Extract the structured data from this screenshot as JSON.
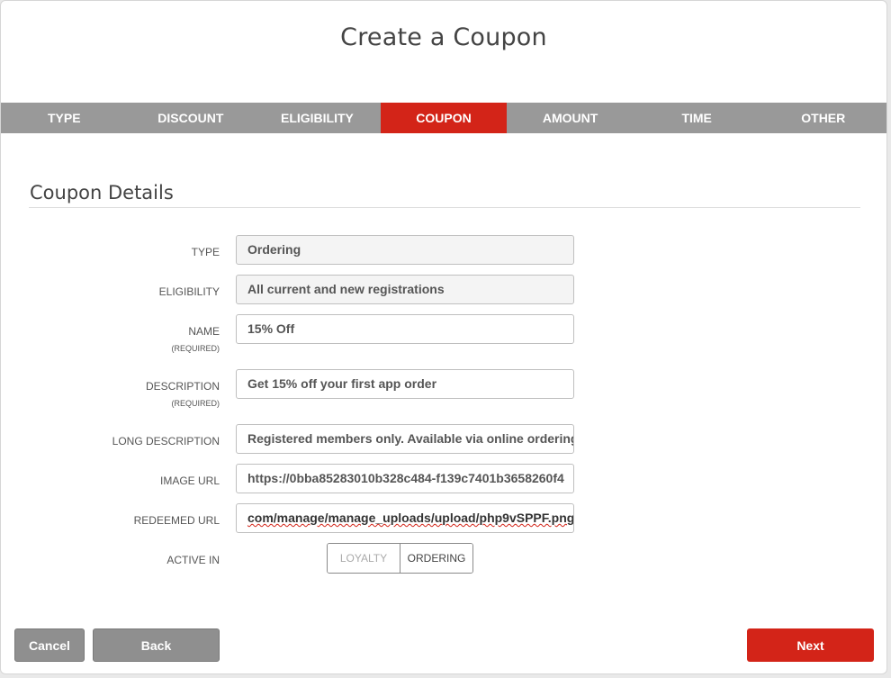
{
  "title": "Create a Coupon",
  "tabs": [
    {
      "label": "TYPE"
    },
    {
      "label": "DISCOUNT"
    },
    {
      "label": "ELIGIBILITY"
    },
    {
      "label": "COUPON",
      "active": true
    },
    {
      "label": "AMOUNT"
    },
    {
      "label": "TIME"
    },
    {
      "label": "OTHER"
    }
  ],
  "section": {
    "title": "Coupon Details"
  },
  "form": {
    "type": {
      "label": "TYPE",
      "value": "Ordering"
    },
    "eligibility": {
      "label": "ELIGIBILITY",
      "value": "All current and new registrations"
    },
    "name": {
      "label": "NAME",
      "required": "(REQUIRED)",
      "value": "15% Off"
    },
    "description": {
      "label": "DESCRIPTION",
      "required": "(REQUIRED)",
      "value": "Get 15% off your first app order"
    },
    "long_description": {
      "label": "LONG DESCRIPTION",
      "value": "Registered members only. Available via online ordering, l"
    },
    "image_url": {
      "label": "IMAGE URL",
      "value": "https://0bba85283010b328c484-f139c7401b3658260f4"
    },
    "redeemed_url": {
      "label": "REDEEMED URL",
      "value_prefix": "com/manage/manage_uploads/upload/",
      "value_file": "php9vSPPF.png"
    },
    "active_in": {
      "label": "ACTIVE IN",
      "options": [
        "LOYALTY",
        "ORDERING"
      ],
      "selected": "ORDERING"
    }
  },
  "buttons": {
    "cancel": "Cancel",
    "back": "Back",
    "next": "Next"
  },
  "colors": {
    "accent": "#d32418",
    "tab_bar": "#999999"
  }
}
